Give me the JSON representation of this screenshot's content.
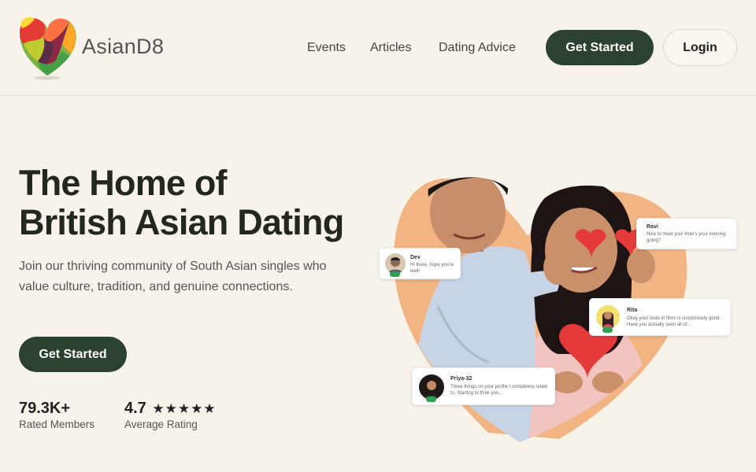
{
  "brand": {
    "name": "AsianD8"
  },
  "nav": {
    "links": [
      "Events",
      "Articles",
      "Dating Advice"
    ],
    "get_started": "Get Started",
    "login": "Login"
  },
  "hero": {
    "title_line1": "The Home of",
    "title_line2": "British Asian Dating",
    "subtitle": "Join our thriving community of South Asian singles who value culture, tradition, and genuine connections.",
    "cta": "Get Started"
  },
  "stats": [
    {
      "value": "79.3K+",
      "label": "Rated Members"
    },
    {
      "value": "4.7",
      "stars": "★★★★★",
      "label": "Average Rating"
    }
  ],
  "chats": [
    {
      "name": "Dev",
      "message": "Hi there, hope you're well!"
    },
    {
      "name": "Ravi",
      "message": "Nice to meet you! How's your evening going?"
    },
    {
      "name": "Rita",
      "message": "Okay your taste in films is suspiciously good. Have you actually seen all of..."
    },
    {
      "name": "Priya-32",
      "message": "Three things on your profile I completely relate to. Starting to think you..."
    }
  ],
  "colors": {
    "background": "#f8f3ea",
    "primary": "#2c4230",
    "accent_blob": "#f2b483",
    "heart": "#e53a3a",
    "online": "#2e9e4f"
  }
}
